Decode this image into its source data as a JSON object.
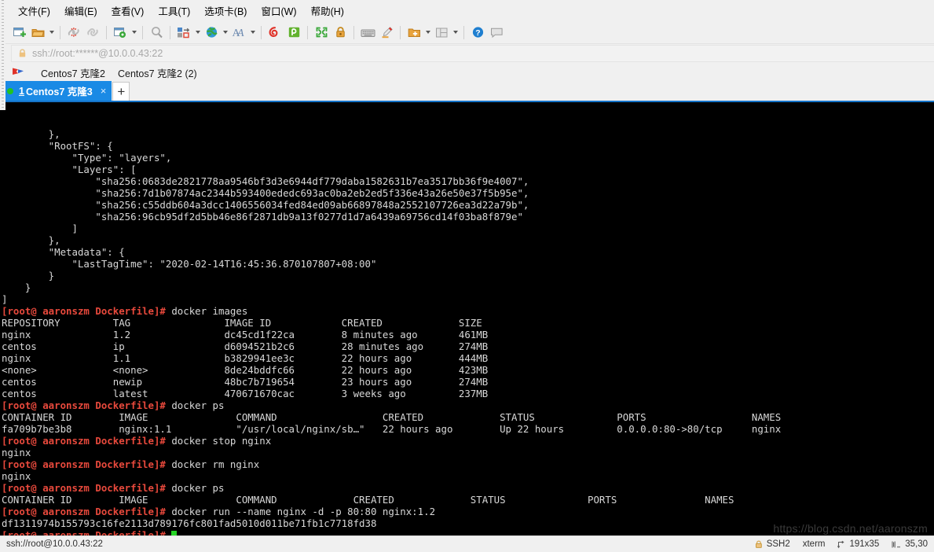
{
  "menubar": {
    "items": [
      {
        "label": "文件(F)",
        "name": "menu-file"
      },
      {
        "label": "编辑(E)",
        "name": "menu-edit"
      },
      {
        "label": "查看(V)",
        "name": "menu-view"
      },
      {
        "label": "工具(T)",
        "name": "menu-tools"
      },
      {
        "label": "选项卡(B)",
        "name": "menu-tabs"
      },
      {
        "label": "窗口(W)",
        "name": "menu-window"
      },
      {
        "label": "帮助(H)",
        "name": "menu-help"
      }
    ]
  },
  "toolbar": {
    "icons": [
      "new-session-icon",
      "open-folder-icon",
      "disconnect-icon",
      "reconnect-icon",
      "session-options-icon",
      "search-icon",
      "transfer-icon",
      "globe-icon",
      "font-icon",
      "spiral-icon",
      "snippet-icon",
      "fullscreen-icon",
      "lock-icon",
      "keyboard-icon",
      "highlighter-icon",
      "add-folder-icon",
      "layout-icon",
      "help-icon",
      "comment-icon"
    ]
  },
  "address_bar": {
    "value": "ssh://root:******@10.0.0.43:22",
    "icon": "lock-icon"
  },
  "session_bar": {
    "icon": "red-flag-icon",
    "items": [
      {
        "label": "Centos7 克隆2",
        "name": "session-centos7-clone2"
      },
      {
        "label": "Centos7 克隆2 (2)",
        "name": "session-centos7-clone2-2"
      }
    ]
  },
  "tabs": {
    "active": {
      "number": "1",
      "label": "Centos7 克隆3",
      "close_label": "×",
      "status_dot_color": "#21c421"
    },
    "add_label": "+"
  },
  "terminal": {
    "lines": [
      {
        "type": "out",
        "text": "        },"
      },
      {
        "type": "out",
        "text": "        \"RootFS\": {"
      },
      {
        "type": "out",
        "text": "            \"Type\": \"layers\","
      },
      {
        "type": "out",
        "text": "            \"Layers\": ["
      },
      {
        "type": "out",
        "text": "                \"sha256:0683de2821778aa9546bf3d3e6944df779daba1582631b7ea3517bb36f9e4007\","
      },
      {
        "type": "out",
        "text": "                \"sha256:7d1b07874ac2344b593400ededc693ac0ba2eb2ed5f336e43a26e50e37f5b95e\","
      },
      {
        "type": "out",
        "text": "                \"sha256:c55ddb604a3dcc1406556034fed84ed09ab66897848a2552107726ea3d22a79b\","
      },
      {
        "type": "out",
        "text": "                \"sha256:96cb95df2d5bb46e86f2871db9a13f0277d1d7a6439a69756cd14f03ba8f879e\""
      },
      {
        "type": "out",
        "text": "            ]"
      },
      {
        "type": "out",
        "text": "        },"
      },
      {
        "type": "out",
        "text": "        \"Metadata\": {"
      },
      {
        "type": "out",
        "text": "            \"LastTagTime\": \"2020-02-14T16:45:36.870107807+08:00\""
      },
      {
        "type": "out",
        "text": "        }"
      },
      {
        "type": "out",
        "text": "    }"
      },
      {
        "type": "out",
        "text": "]"
      },
      {
        "type": "cmd",
        "prompt": "[root@ aaronszm Dockerfile]#",
        "text": " docker images"
      },
      {
        "type": "out",
        "text": "REPOSITORY         TAG                IMAGE ID            CREATED             SIZE"
      },
      {
        "type": "out",
        "text": "nginx              1.2                dc45cd1f22ca        8 minutes ago       461MB"
      },
      {
        "type": "out",
        "text": "centos             ip                 d6094521b2c6        28 minutes ago      274MB"
      },
      {
        "type": "out",
        "text": "nginx              1.1                b3829941ee3c        22 hours ago        444MB"
      },
      {
        "type": "out",
        "text": "<none>             <none>             8de24bddfc66        22 hours ago        423MB"
      },
      {
        "type": "out",
        "text": "centos             newip              48bc7b719654        23 hours ago        274MB"
      },
      {
        "type": "out",
        "text": "centos             latest             470671670cac        3 weeks ago         237MB"
      },
      {
        "type": "cmd",
        "prompt": "[root@ aaronszm Dockerfile]#",
        "text": " docker ps"
      },
      {
        "type": "out",
        "text": "CONTAINER ID        IMAGE               COMMAND                  CREATED             STATUS              PORTS                  NAMES"
      },
      {
        "type": "out",
        "text": "fa709b7be3b8        nginx:1.1           \"/usr/local/nginx/sb…\"   22 hours ago        Up 22 hours         0.0.0.0:80->80/tcp     nginx"
      },
      {
        "type": "cmd",
        "prompt": "[root@ aaronszm Dockerfile]#",
        "text": " docker stop nginx"
      },
      {
        "type": "out",
        "text": "nginx"
      },
      {
        "type": "cmd",
        "prompt": "[root@ aaronszm Dockerfile]#",
        "text": " docker rm nginx"
      },
      {
        "type": "out",
        "text": "nginx"
      },
      {
        "type": "cmd",
        "prompt": "[root@ aaronszm Dockerfile]#",
        "text": " docker ps"
      },
      {
        "type": "out",
        "text": "CONTAINER ID        IMAGE               COMMAND             CREATED             STATUS              PORTS               NAMES"
      },
      {
        "type": "cmd",
        "prompt": "[root@ aaronszm Dockerfile]#",
        "text": " docker run --name nginx -d -p 80:80 nginx:1.2"
      },
      {
        "type": "out",
        "text": "df1311974b155793c16fe2113d789176fc801fad5010d011be71fb1c7718fd38"
      },
      {
        "type": "cmd",
        "prompt": "[root@ aaronszm Dockerfile]#",
        "text": " ",
        "cursor": true
      }
    ],
    "watermark": "https://blog.csdn.net/aaronszm",
    "colors": {
      "background": "#000000",
      "foreground": "#d8d8d8",
      "prompt": "#e8493c",
      "cursor": "#25d425"
    }
  },
  "statusbar": {
    "connection": "ssh://root@10.0.0.43:22",
    "protocol": "SSH2",
    "terminal_type": "xterm",
    "size": "191x35",
    "cursor_position": "35,30",
    "lock_icon": "lock-icon",
    "size_icon": "resize-icon",
    "cursor_icon": "cursor-pos-icon"
  }
}
